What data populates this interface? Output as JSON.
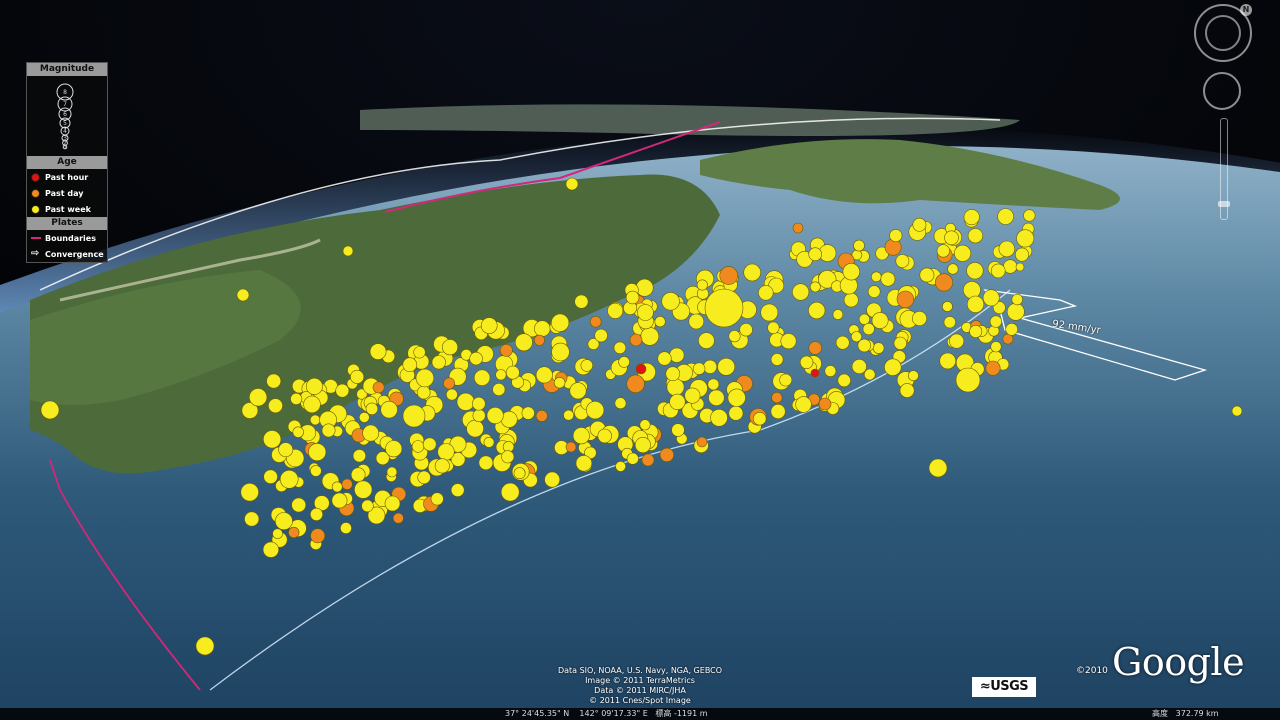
{
  "legend": {
    "magnitude_title": "Magnitude",
    "magnitude_scale": [
      "8",
      "7",
      "6",
      "5",
      "4",
      "3",
      "2",
      "1"
    ],
    "age_title": "Age",
    "age_items": [
      {
        "label": "Past hour",
        "color": "#e01414"
      },
      {
        "label": "Past day",
        "color": "#f08a1e"
      },
      {
        "label": "Past week",
        "color": "#f6ec1e"
      }
    ],
    "plates_title": "Plates",
    "plates_items": [
      {
        "label": "Boundaries",
        "icon": "boundary-line-icon",
        "color": "#d2287a"
      },
      {
        "label": "Convergence",
        "icon": "convergence-arrow-icon",
        "color": "#ffffff"
      }
    ]
  },
  "convergence_label": "92 mm/yr",
  "credits": [
    "Data SIO, NOAA, U.S. Navy, NGA, GEBCO",
    "Image © 2011 TerraMetrics",
    "Data © 2011 MIRC/JHA",
    "© 2011 Cnes/Spot Image"
  ],
  "usgs_logo": "≈USGS",
  "google_copyright": "©2010",
  "google_logo": "Google",
  "status": {
    "coordinates": "37° 24'45.35\" N    142° 09'17.33\" E",
    "elevation_label": "標高",
    "elevation_value": "-1191 m",
    "altitude_label": "高度",
    "altitude_value": "372.79 km"
  },
  "nav": {
    "compass_icon": "compass-icon",
    "north_label": "N",
    "look_icon": "look-joystick-icon"
  },
  "colors": {
    "hour": "#e01414",
    "day": "#f08a1e",
    "week": "#f6ec1e",
    "boundary": "#d2287a"
  }
}
